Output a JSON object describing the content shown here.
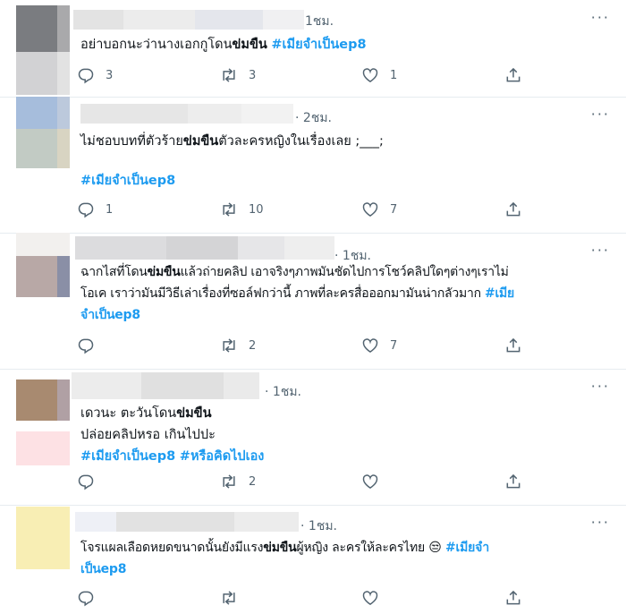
{
  "tweets": [
    {
      "time": "1ชม.",
      "more": "···",
      "line1_pre": "อย่าบอกนะว่านางเอกกูโดน",
      "line1_bold": "ข่มขืน",
      "line1_post": "",
      "line1_tag": "#เมียจำเป็นep8",
      "reply_count": "3",
      "retweet_count": "3",
      "like_count": "1"
    },
    {
      "time": "2ชม.",
      "more": "···",
      "line1_pre": "ไม่ชอบบทที่ตัวร้าย",
      "line1_bold": "ข่มขืน",
      "line1_post": "ตัวละครหญิงในเรื่องเลย ;___;",
      "tag": "#เมียจำเป็นep8",
      "reply_count": "1",
      "retweet_count": "10",
      "like_count": "7"
    },
    {
      "time": "1ชม.",
      "more": "···",
      "line1_pre": "ฉากไสที่โดน",
      "line1_bold": "ข่มขืน",
      "line1_post": "แล้วถ่ายคลิป เอาจริงๆภาพมันชัดไปการโชว์คลิปใดๆต่างๆเราไม่",
      "line2": "โอเค เราว่ามันมีวิธีเล่าเรื่องที่ซอล์ฟกว่านี้ ภาพที่ละครสื่อออกมามันน่ากลัวมาก",
      "line2_tag": "#เมีย",
      "line3_tag": "จำเป็นep8",
      "reply_count": "",
      "retweet_count": "2",
      "like_count": "7"
    },
    {
      "time": "1ชม.",
      "more": "···",
      "line1_pre": "เดวนะ ตะวันโดน",
      "line1_bold": "ข่มขืน",
      "line2": "ปล่อยคลิปหรอ เกินไปปะ",
      "tag1": "#เมียจำเป็นep8",
      "tag2": "#หรือคิดไปเอง",
      "reply_count": "",
      "retweet_count": "2",
      "like_count": ""
    },
    {
      "time": "1ชม.",
      "more": "···",
      "line1_pre": "โจรแผลเลือดหยดขนาดนั้นยังมีแรง",
      "line1_bold": "ข่มขืน",
      "line1_post": "ผู้หญิง ละครให้ละครไทย",
      "emoji": "😒",
      "line1_tag": "#เมียจำ",
      "line2_tag": "เป็นep8",
      "reply_count": "",
      "retweet_count": "",
      "like_count": ""
    }
  ],
  "colors": {
    "accent": "#1d9bf0",
    "muted": "#536471",
    "text": "#0f1419"
  },
  "icons": [
    "reply-icon",
    "retweet-icon",
    "like-icon",
    "share-icon",
    "more-icon"
  ]
}
